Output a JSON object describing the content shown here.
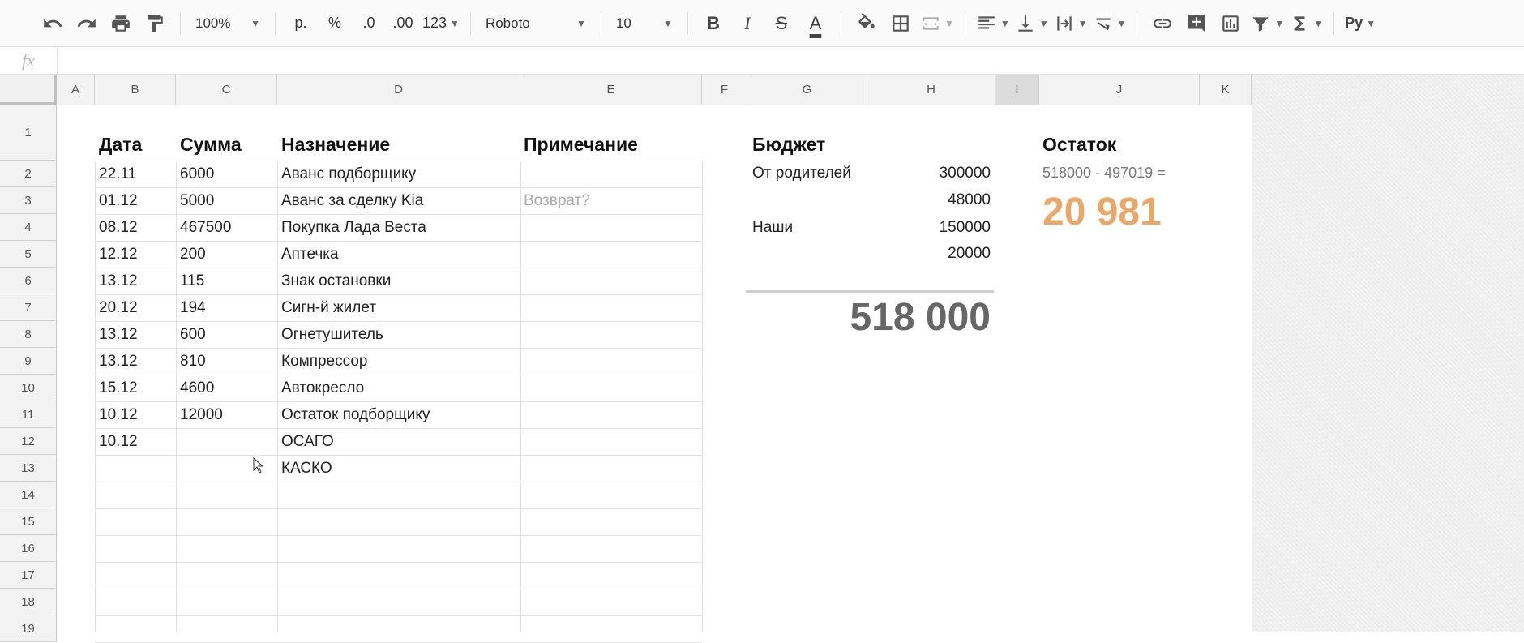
{
  "toolbar": {
    "zoom": "100%",
    "currency": "р.",
    "percent": "%",
    "dec_decrease": ".0",
    "dec_increase": ".00",
    "more_formats": "123",
    "font": "Roboto",
    "font_size": "10",
    "bold": "B",
    "italic": "I",
    "strike": "S",
    "text_color": "A",
    "input_tools": "Py",
    "text_color_value": "#000000"
  },
  "formula_bar": {
    "fx": "fx",
    "value": ""
  },
  "columns": [
    "A",
    "B",
    "C",
    "D",
    "E",
    "F",
    "G",
    "H",
    "I",
    "J",
    "K"
  ],
  "selected_column": "I",
  "rows": [
    "1",
    "2",
    "3",
    "4",
    "5",
    "6",
    "7",
    "8",
    "9",
    "10",
    "11",
    "12",
    "13",
    "14",
    "15",
    "16",
    "17",
    "18",
    "19"
  ],
  "table": {
    "headers": {
      "date": "Дата",
      "amount": "Сумма",
      "purpose": "Назначение",
      "note": "Примечание"
    },
    "entries": [
      {
        "date": "22.11",
        "amount": "6000",
        "purpose": "Аванс подборщику",
        "note": ""
      },
      {
        "date": "01.12",
        "amount": "5000",
        "purpose": "Аванс за сделку Kia",
        "note": "Возврат?"
      },
      {
        "date": "08.12",
        "amount": "467500",
        "purpose": "Покупка Лада Веста",
        "note": ""
      },
      {
        "date": "12.12",
        "amount": "200",
        "purpose": "Аптечка",
        "note": ""
      },
      {
        "date": "13.12",
        "amount": "115",
        "purpose": "Знак остановки",
        "note": ""
      },
      {
        "date": "20.12",
        "amount": "194",
        "purpose": "Сигн-й жилет",
        "note": ""
      },
      {
        "date": "13.12",
        "amount": "600",
        "purpose": "Огнетушитель",
        "note": ""
      },
      {
        "date": "13.12",
        "amount": "810",
        "purpose": "Компрессор",
        "note": ""
      },
      {
        "date": "15.12",
        "amount": "4600",
        "purpose": "Автокресло",
        "note": ""
      },
      {
        "date": "10.12",
        "amount": "12000",
        "purpose": "Остаток подборщику",
        "note": ""
      },
      {
        "date": "10.12",
        "amount": "",
        "purpose": "ОСАГО",
        "note": ""
      },
      {
        "date": "",
        "amount": "",
        "purpose": "КАСКО",
        "note": ""
      }
    ]
  },
  "budget": {
    "title": "Бюджет",
    "items": [
      {
        "label": "От родителей",
        "value": "300000"
      },
      {
        "label": "",
        "value": "48000"
      },
      {
        "label": "Наши",
        "value": "150000"
      },
      {
        "label": "",
        "value": "20000"
      }
    ],
    "total": "518 000"
  },
  "remainder": {
    "title": "Остаток",
    "formula": "518000 - 497019 =",
    "value": "20 981",
    "color": "#e8a86a"
  }
}
